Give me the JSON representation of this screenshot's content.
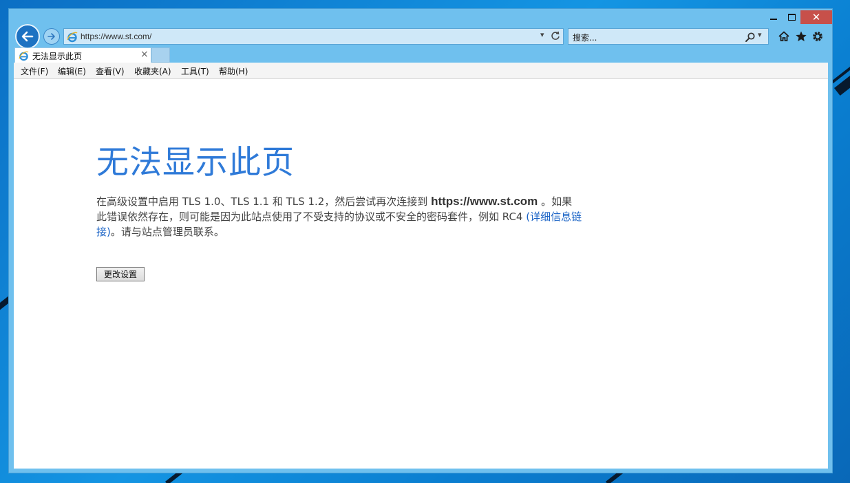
{
  "window": {
    "controls": {
      "minimize": "",
      "maximize": "",
      "close": "✕"
    }
  },
  "toolbar": {
    "address_url": "https://www.st.com/",
    "search_placeholder": "搜索..."
  },
  "tabs": [
    {
      "label": "无法显示此页"
    }
  ],
  "menu": {
    "items": [
      "文件(F)",
      "编辑(E)",
      "查看(V)",
      "收藏夹(A)",
      "工具(T)",
      "帮助(H)"
    ]
  },
  "page": {
    "title": "无法显示此页",
    "message_part1": "在高级设置中启用 TLS 1.0、TLS 1.1 和 TLS 1.2，然后尝试再次连接到 ",
    "site": "https://www.st.com",
    "message_part2": " 。如果此错误依然存在，则可能是因为此站点使用了不受支持的协议或不安全的密码套件，例如 RC4 ",
    "details_link": "(详细信息链接)",
    "message_part3": "。请与站点管理员联系。",
    "change_settings_button": "更改设置"
  },
  "colors": {
    "title_blue": "#2f7ad8",
    "link_blue": "#1a63c6",
    "chrome_blue": "#6fc0ee",
    "close_red": "#c7504a"
  },
  "icons": [
    "back-arrow-icon",
    "forward-arrow-icon",
    "ie-logo-icon",
    "dropdown-icon",
    "refresh-icon",
    "search-icon",
    "home-icon",
    "favorites-star-icon",
    "settings-gear-icon",
    "close-icon"
  ]
}
